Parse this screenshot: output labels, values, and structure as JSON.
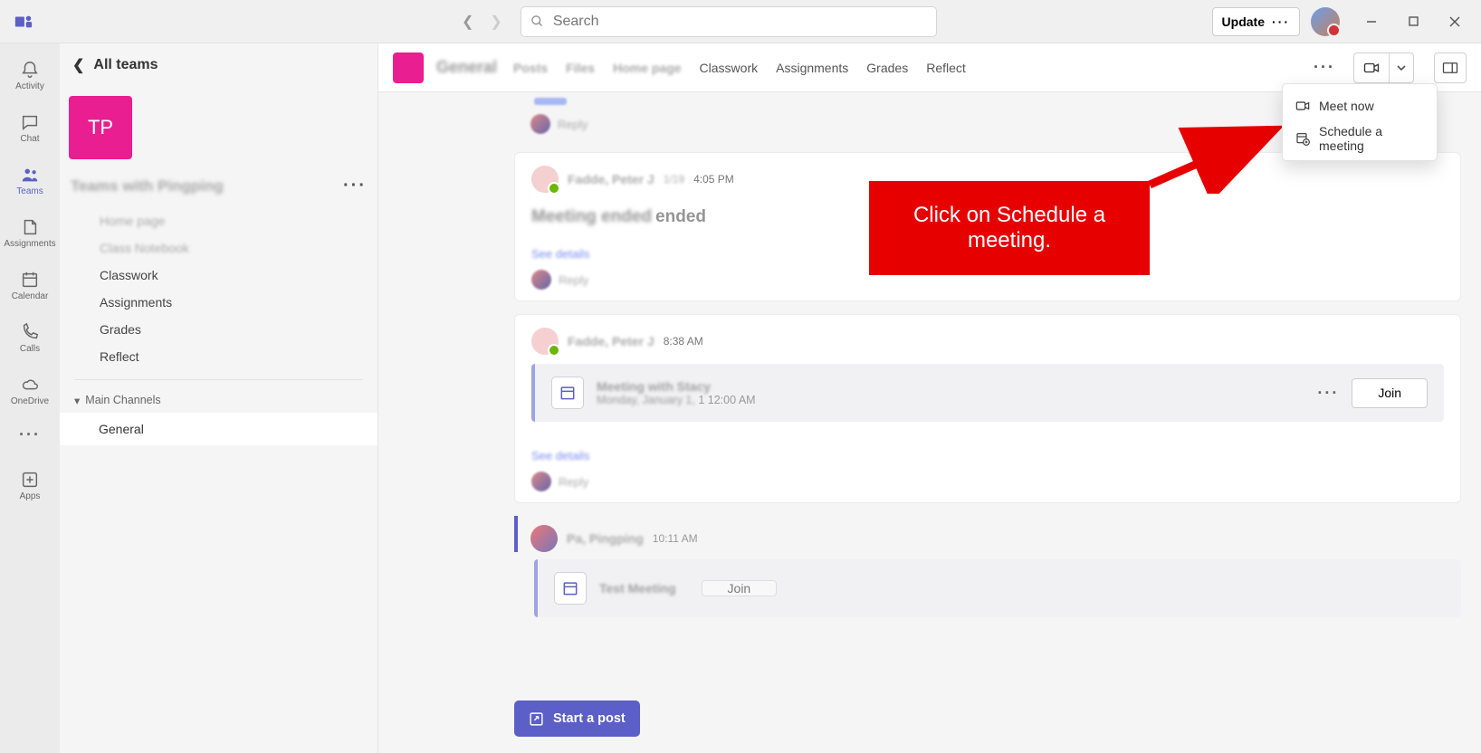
{
  "titlebar": {
    "search_placeholder": "Search",
    "update_label": "Update"
  },
  "rail": {
    "items": [
      {
        "label": "Activity"
      },
      {
        "label": "Chat"
      },
      {
        "label": "Teams"
      },
      {
        "label": "Assignments"
      },
      {
        "label": "Calendar"
      },
      {
        "label": "Calls"
      },
      {
        "label": "OneDrive"
      }
    ],
    "apps_label": "Apps"
  },
  "sidebar": {
    "back_label": "All teams",
    "team_initials": "TP",
    "team_name": "Teams with Pingping",
    "items": [
      {
        "label": "Home page",
        "blur": true
      },
      {
        "label": "Class Notebook",
        "blur": true
      },
      {
        "label": "Classwork",
        "blur": false
      },
      {
        "label": "Assignments",
        "blur": false
      },
      {
        "label": "Grades",
        "blur": false
      },
      {
        "label": "Reflect",
        "blur": false
      }
    ],
    "group_label": "Main Channels",
    "channel_label": "General"
  },
  "channel_header": {
    "title": "General",
    "tabs": [
      {
        "label": "Posts",
        "blur": true
      },
      {
        "label": "Files",
        "blur": true
      },
      {
        "label": "Home page",
        "blur": true
      },
      {
        "label": "Classwork",
        "blur": false
      },
      {
        "label": "Assignments",
        "blur": false
      },
      {
        "label": "Grades",
        "blur": false
      },
      {
        "label": "Reflect",
        "blur": false
      }
    ]
  },
  "dropdown": {
    "meet_now": "Meet now",
    "schedule": "Schedule a meeting"
  },
  "posts": {
    "reply0": "Reply",
    "p1_author": "Fadde, Peter J",
    "p1_date": "1/19",
    "p1_time": "4:05 PM",
    "p1_body_blur": "Meeting ended",
    "p1_body_clear": "ended",
    "see_details": "See details",
    "reply": "Reply",
    "p2_author": "Fadde, Peter J",
    "p2_time": "8:38 AM",
    "p2_meeting_title": "Meeting with Stacy",
    "p2_meeting_sub_blur": "Monday, January 1,",
    "p2_meeting_sub_clear": "1 12:00 AM",
    "join_label": "Join",
    "p3_author": "Pa, Pingping",
    "p3_time": "10:11 AM",
    "p3_meeting_title": "Test Meeting"
  },
  "compose": {
    "start_post": "Start a post"
  },
  "callout": {
    "text": "Click on Schedule a meeting."
  }
}
